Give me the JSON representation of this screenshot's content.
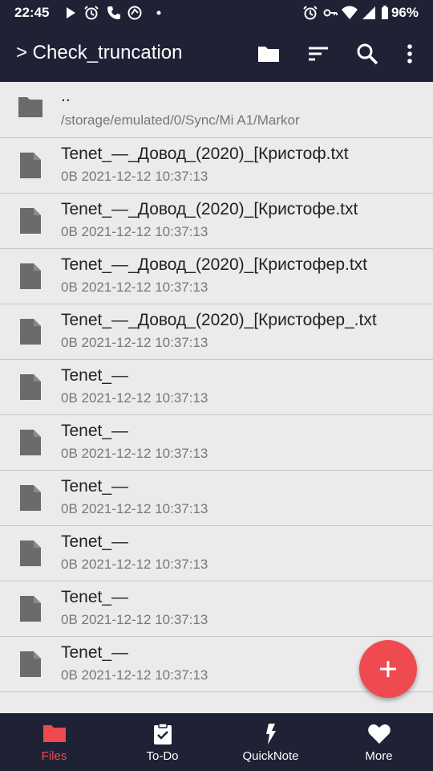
{
  "status_bar": {
    "time": "22:45",
    "battery": "96%"
  },
  "app_bar": {
    "title": "> Check_truncation"
  },
  "parent_dir": {
    "name": "..",
    "path": "/storage/emulated/0/Sync/Mi A1/Markor"
  },
  "files": [
    {
      "name": "Tenet_—_Довод_(2020)_[Кристоф.txt",
      "meta": "0B 2021-12-12 10:37:13"
    },
    {
      "name": "Tenet_—_Довод_(2020)_[Кристофе.txt",
      "meta": "0B 2021-12-12 10:37:13"
    },
    {
      "name": "Tenet_—_Довод_(2020)_[Кристофер.txt",
      "meta": "0B 2021-12-12 10:37:13"
    },
    {
      "name": "Tenet_—_Довод_(2020)_[Кристофер_.txt",
      "meta": "0B 2021-12-12 10:37:13"
    },
    {
      "name": "Tenet_—",
      "meta": "0B 2021-12-12 10:37:13"
    },
    {
      "name": "Tenet_—",
      "meta": "0B 2021-12-12 10:37:13"
    },
    {
      "name": "Tenet_—",
      "meta": "0B 2021-12-12 10:37:13"
    },
    {
      "name": "Tenet_—",
      "meta": "0B 2021-12-12 10:37:13"
    },
    {
      "name": "Tenet_—",
      "meta": "0B 2021-12-12 10:37:13"
    },
    {
      "name": "Tenet_—",
      "meta": "0B 2021-12-12 10:37:13"
    }
  ],
  "bottom_nav": [
    {
      "label": "Files",
      "icon": "folder-icon",
      "active": true
    },
    {
      "label": "To-Do",
      "icon": "clipboard-check-icon",
      "active": false
    },
    {
      "label": "QuickNote",
      "icon": "lightning-icon",
      "active": false
    },
    {
      "label": "More",
      "icon": "heart-icon",
      "active": false
    }
  ],
  "colors": {
    "bar": "#1f2235",
    "accent": "#ef4a4f",
    "list_bg": "#ebebeb"
  }
}
